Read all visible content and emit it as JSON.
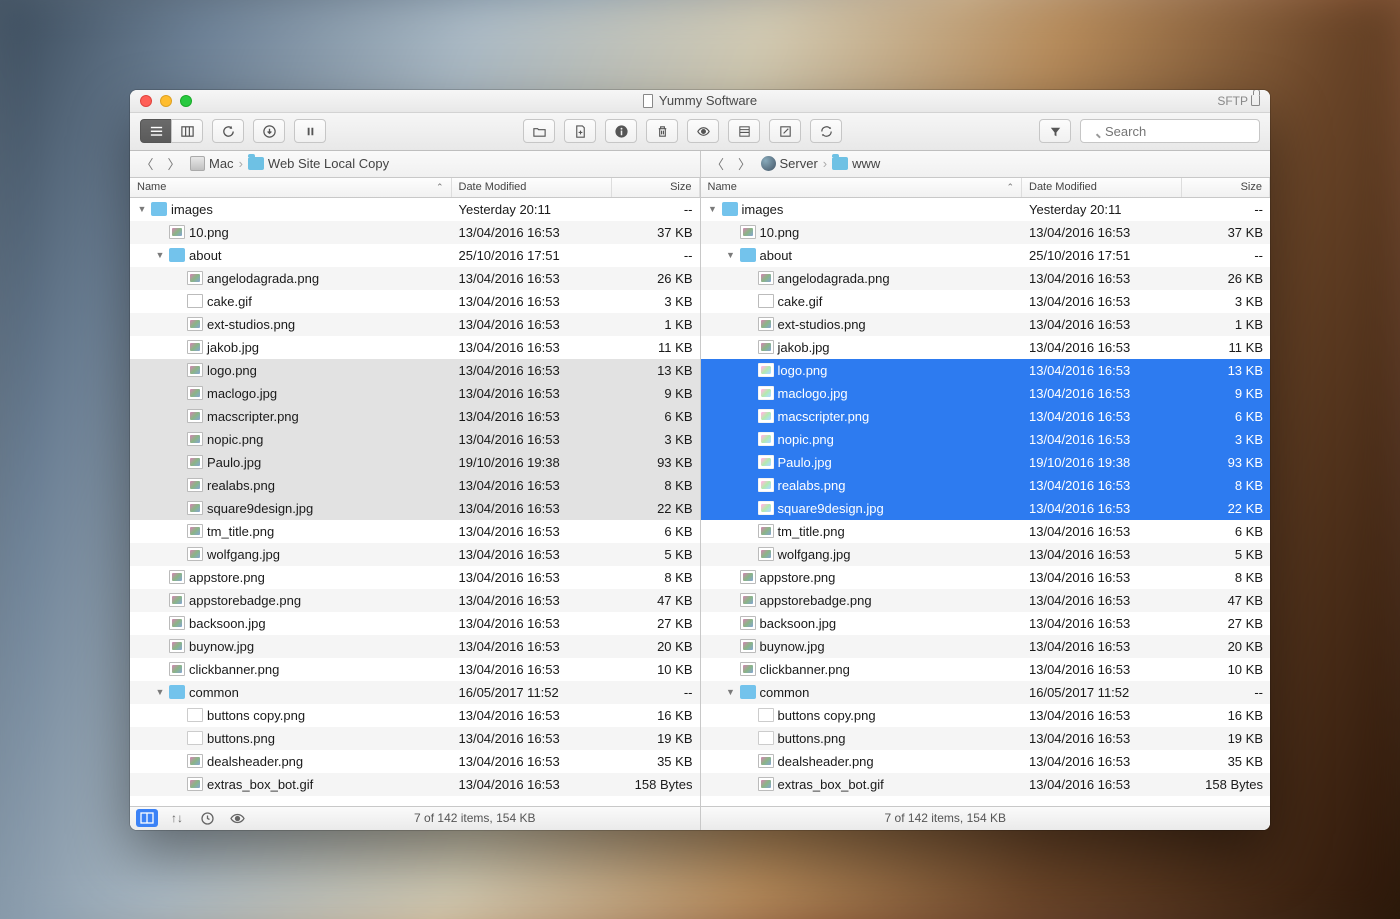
{
  "window": {
    "title": "Yummy Software",
    "protocol": "SFTP"
  },
  "toolbar": {
    "search_placeholder": "Search"
  },
  "columns": {
    "name": "Name",
    "date": "Date Modified",
    "size": "Size"
  },
  "left": {
    "path": {
      "root": "Mac",
      "folder": "Web Site Local Copy"
    },
    "status": "7 of 142 items, 154 KB",
    "rows": [
      {
        "indent": 0,
        "d": "down",
        "ico": "folder",
        "name": "images",
        "date": "Yesterday 20:11",
        "size": "--"
      },
      {
        "indent": 1,
        "ico": "img",
        "name": "10.png",
        "date": "13/04/2016 16:53",
        "size": "37 KB"
      },
      {
        "indent": 1,
        "d": "down",
        "ico": "folder",
        "name": "about",
        "date": "25/10/2016 17:51",
        "size": "--"
      },
      {
        "indent": 2,
        "ico": "img",
        "name": "angelodagrada.png",
        "date": "13/04/2016 16:53",
        "size": "26 KB"
      },
      {
        "indent": 2,
        "ico": "gif",
        "name": "cake.gif",
        "date": "13/04/2016 16:53",
        "size": "3 KB"
      },
      {
        "indent": 2,
        "ico": "img",
        "name": "ext-studios.png",
        "date": "13/04/2016 16:53",
        "size": "1 KB"
      },
      {
        "indent": 2,
        "ico": "img",
        "name": "jakob.jpg",
        "date": "13/04/2016 16:53",
        "size": "11 KB"
      },
      {
        "indent": 2,
        "ico": "img",
        "name": "logo.png",
        "date": "13/04/2016 16:53",
        "size": "13 KB",
        "hover": true
      },
      {
        "indent": 2,
        "ico": "img",
        "name": "maclogo.jpg",
        "date": "13/04/2016 16:53",
        "size": "9 KB",
        "hover": true
      },
      {
        "indent": 2,
        "ico": "img",
        "name": "macscripter.png",
        "date": "13/04/2016 16:53",
        "size": "6 KB",
        "hover": true
      },
      {
        "indent": 2,
        "ico": "img",
        "name": "nopic.png",
        "date": "13/04/2016 16:53",
        "size": "3 KB",
        "hover": true
      },
      {
        "indent": 2,
        "ico": "img",
        "name": "Paulo.jpg",
        "date": "19/10/2016 19:38",
        "size": "93 KB",
        "hover": true
      },
      {
        "indent": 2,
        "ico": "img",
        "name": "realabs.png",
        "date": "13/04/2016 16:53",
        "size": "8 KB",
        "hover": true
      },
      {
        "indent": 2,
        "ico": "img",
        "name": "square9design.jpg",
        "date": "13/04/2016 16:53",
        "size": "22 KB",
        "hover": true
      },
      {
        "indent": 2,
        "ico": "img",
        "name": "tm_title.png",
        "date": "13/04/2016 16:53",
        "size": "6 KB"
      },
      {
        "indent": 2,
        "ico": "img",
        "name": "wolfgang.jpg",
        "date": "13/04/2016 16:53",
        "size": "5 KB"
      },
      {
        "indent": 1,
        "ico": "img",
        "name": "appstore.png",
        "date": "13/04/2016 16:53",
        "size": "8 KB"
      },
      {
        "indent": 1,
        "ico": "img",
        "name": "appstorebadge.png",
        "date": "13/04/2016 16:53",
        "size": "47 KB"
      },
      {
        "indent": 1,
        "ico": "img",
        "name": "backsoon.jpg",
        "date": "13/04/2016 16:53",
        "size": "27 KB"
      },
      {
        "indent": 1,
        "ico": "img",
        "name": "buynow.jpg",
        "date": "13/04/2016 16:53",
        "size": "20 KB"
      },
      {
        "indent": 1,
        "ico": "img",
        "name": "clickbanner.png",
        "date": "13/04/2016 16:53",
        "size": "10 KB"
      },
      {
        "indent": 1,
        "d": "down",
        "ico": "folder",
        "name": "common",
        "date": "16/05/2017 11:52",
        "size": "--"
      },
      {
        "indent": 2,
        "ico": "blank",
        "name": "buttons copy.png",
        "date": "13/04/2016 16:53",
        "size": "16 KB"
      },
      {
        "indent": 2,
        "ico": "blank",
        "name": "buttons.png",
        "date": "13/04/2016 16:53",
        "size": "19 KB"
      },
      {
        "indent": 2,
        "ico": "img",
        "name": "dealsheader.png",
        "date": "13/04/2016 16:53",
        "size": "35 KB"
      },
      {
        "indent": 2,
        "ico": "img",
        "name": "extras_box_bot.gif",
        "date": "13/04/2016 16:53",
        "size": "158 Bytes"
      }
    ]
  },
  "right": {
    "path": {
      "root": "Server",
      "folder": "www"
    },
    "status": "7 of 142 items, 154 KB",
    "rows": [
      {
        "indent": 0,
        "d": "down",
        "ico": "folder",
        "name": "images",
        "date": "Yesterday 20:11",
        "size": "--"
      },
      {
        "indent": 1,
        "ico": "img",
        "name": "10.png",
        "date": "13/04/2016 16:53",
        "size": "37 KB"
      },
      {
        "indent": 1,
        "d": "down",
        "ico": "folder",
        "name": "about",
        "date": "25/10/2016 17:51",
        "size": "--"
      },
      {
        "indent": 2,
        "ico": "img",
        "name": "angelodagrada.png",
        "date": "13/04/2016 16:53",
        "size": "26 KB"
      },
      {
        "indent": 2,
        "ico": "gif",
        "name": "cake.gif",
        "date": "13/04/2016 16:53",
        "size": "3 KB"
      },
      {
        "indent": 2,
        "ico": "img",
        "name": "ext-studios.png",
        "date": "13/04/2016 16:53",
        "size": "1 KB"
      },
      {
        "indent": 2,
        "ico": "img",
        "name": "jakob.jpg",
        "date": "13/04/2016 16:53",
        "size": "11 KB"
      },
      {
        "indent": 2,
        "ico": "img",
        "name": "logo.png",
        "date": "13/04/2016 16:53",
        "size": "13 KB",
        "sel": true
      },
      {
        "indent": 2,
        "ico": "img",
        "name": "maclogo.jpg",
        "date": "13/04/2016 16:53",
        "size": "9 KB",
        "sel": true
      },
      {
        "indent": 2,
        "ico": "img",
        "name": "macscripter.png",
        "date": "13/04/2016 16:53",
        "size": "6 KB",
        "sel": true
      },
      {
        "indent": 2,
        "ico": "img",
        "name": "nopic.png",
        "date": "13/04/2016 16:53",
        "size": "3 KB",
        "sel": true
      },
      {
        "indent": 2,
        "ico": "img",
        "name": "Paulo.jpg",
        "date": "19/10/2016 19:38",
        "size": "93 KB",
        "sel": true
      },
      {
        "indent": 2,
        "ico": "img",
        "name": "realabs.png",
        "date": "13/04/2016 16:53",
        "size": "8 KB",
        "sel": true
      },
      {
        "indent": 2,
        "ico": "img",
        "name": "square9design.jpg",
        "date": "13/04/2016 16:53",
        "size": "22 KB",
        "sel": true
      },
      {
        "indent": 2,
        "ico": "img",
        "name": "tm_title.png",
        "date": "13/04/2016 16:53",
        "size": "6 KB"
      },
      {
        "indent": 2,
        "ico": "img",
        "name": "wolfgang.jpg",
        "date": "13/04/2016 16:53",
        "size": "5 KB"
      },
      {
        "indent": 1,
        "ico": "img",
        "name": "appstore.png",
        "date": "13/04/2016 16:53",
        "size": "8 KB"
      },
      {
        "indent": 1,
        "ico": "img",
        "name": "appstorebadge.png",
        "date": "13/04/2016 16:53",
        "size": "47 KB"
      },
      {
        "indent": 1,
        "ico": "img",
        "name": "backsoon.jpg",
        "date": "13/04/2016 16:53",
        "size": "27 KB"
      },
      {
        "indent": 1,
        "ico": "img",
        "name": "buynow.jpg",
        "date": "13/04/2016 16:53",
        "size": "20 KB"
      },
      {
        "indent": 1,
        "ico": "img",
        "name": "clickbanner.png",
        "date": "13/04/2016 16:53",
        "size": "10 KB"
      },
      {
        "indent": 1,
        "d": "down",
        "ico": "folder",
        "name": "common",
        "date": "16/05/2017 11:52",
        "size": "--"
      },
      {
        "indent": 2,
        "ico": "blank",
        "name": "buttons copy.png",
        "date": "13/04/2016 16:53",
        "size": "16 KB"
      },
      {
        "indent": 2,
        "ico": "blank",
        "name": "buttons.png",
        "date": "13/04/2016 16:53",
        "size": "19 KB"
      },
      {
        "indent": 2,
        "ico": "img",
        "name": "dealsheader.png",
        "date": "13/04/2016 16:53",
        "size": "35 KB"
      },
      {
        "indent": 2,
        "ico": "img",
        "name": "extras_box_bot.gif",
        "date": "13/04/2016 16:53",
        "size": "158 Bytes"
      }
    ]
  }
}
